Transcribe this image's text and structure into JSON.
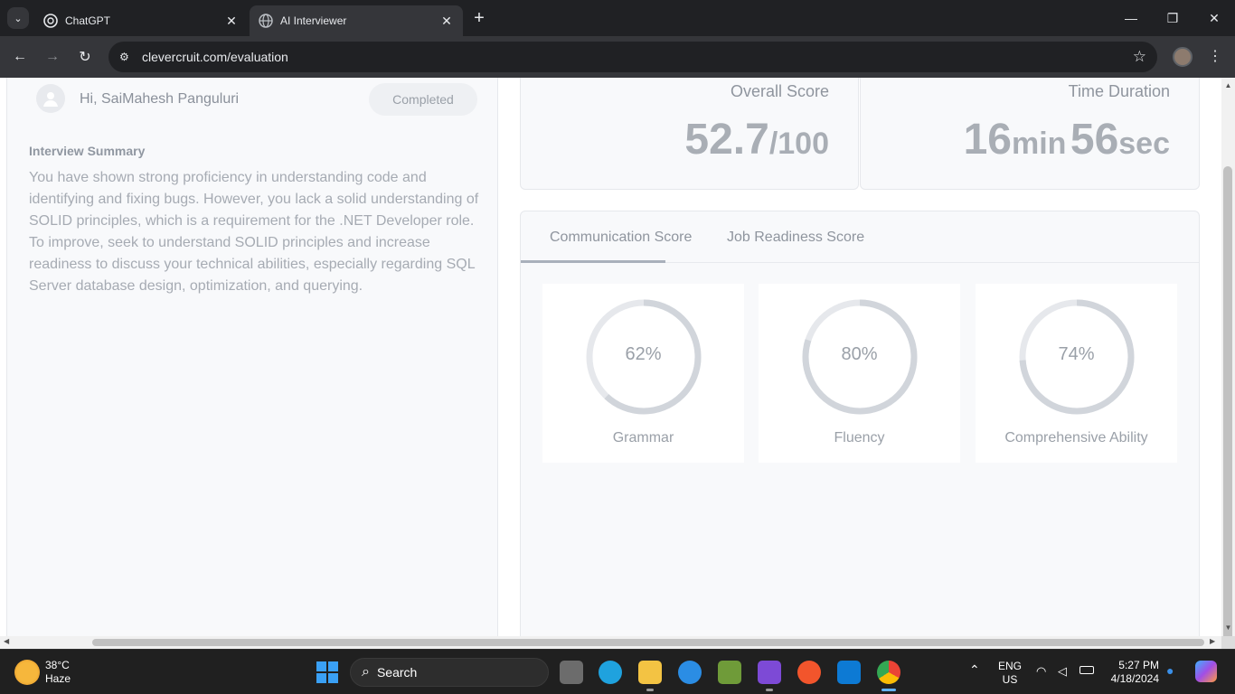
{
  "browser": {
    "tabs": [
      {
        "title": "ChatGPT",
        "favicon": "chatgpt-icon",
        "active": false
      },
      {
        "title": "AI Interviewer",
        "favicon": "globe-icon",
        "active": true
      }
    ],
    "url": "clevercruit.com/evaluation"
  },
  "candidate": {
    "greeting": "Hi, SaiMahesh Panguluri",
    "status": "Completed"
  },
  "summary": {
    "heading": "Interview Summary",
    "text": "You have shown strong proficiency in understanding code and identifying and fixing bugs. However, you lack a solid understanding of SOLID principles, which is a requirement for the .NET Developer role. To improve, seek to understand SOLID principles and increase readiness to discuss your technical abilities, especially regarding SQL Server database design, optimization, and querying."
  },
  "overall": {
    "label": "Overall Score",
    "value": "52.7",
    "suffix": "/100"
  },
  "duration": {
    "label": "Time Duration",
    "minutes": "16",
    "min_unit": "min",
    "seconds": "56",
    "sec_unit": "sec"
  },
  "eval_tabs": {
    "communication": "Communication Score",
    "job_readiness": "Job Readiness Score",
    "active": "communication"
  },
  "metrics": [
    {
      "label": "Grammar",
      "display": "62%",
      "value": 0.62
    },
    {
      "label": "Fluency",
      "display": "80%",
      "value": 0.8
    },
    {
      "label": "Comprehensive Ability",
      "display": "74%",
      "value": 0.74
    }
  ],
  "taskbar": {
    "weather_temp": "38°C",
    "weather_desc": "Haze",
    "search": "Search",
    "lang": "ENG",
    "region": "US",
    "time": "5:27 PM",
    "date": "4/18/2024"
  },
  "colors": {
    "ring_track": "#e6e8ec",
    "ring_fill": "#d1d5db"
  }
}
